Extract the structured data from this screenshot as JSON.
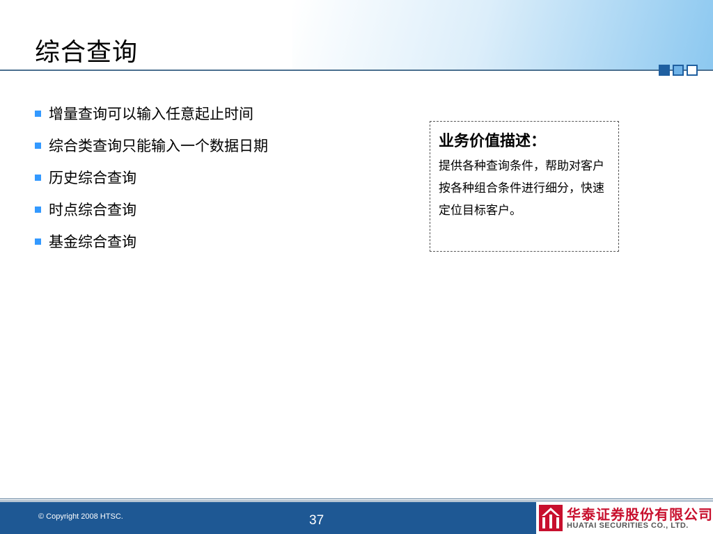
{
  "slide": {
    "title": "综合查询",
    "bullets": [
      "增量查询可以输入任意起止时间",
      "综合类查询只能输入一个数据日期",
      "历史综合查询",
      "时点综合查询",
      "基金综合查询"
    ],
    "value_box": {
      "title": "业务价值描述：",
      "description": "提供各种查询条件，帮助对客户按各种组合条件进行细分，快速定位目标客户。"
    }
  },
  "footer": {
    "copyright": "© Copyright 2008 HTSC.",
    "page_number": "37",
    "logo_cn": "华泰证券股份有限公司",
    "logo_en": "HUATAI SECURITIES CO., LTD."
  },
  "colors": {
    "accent": "#1f5fa0",
    "bullet": "#3399ff",
    "footer_bar": "#1e5894",
    "logo_red": "#c8102e"
  }
}
